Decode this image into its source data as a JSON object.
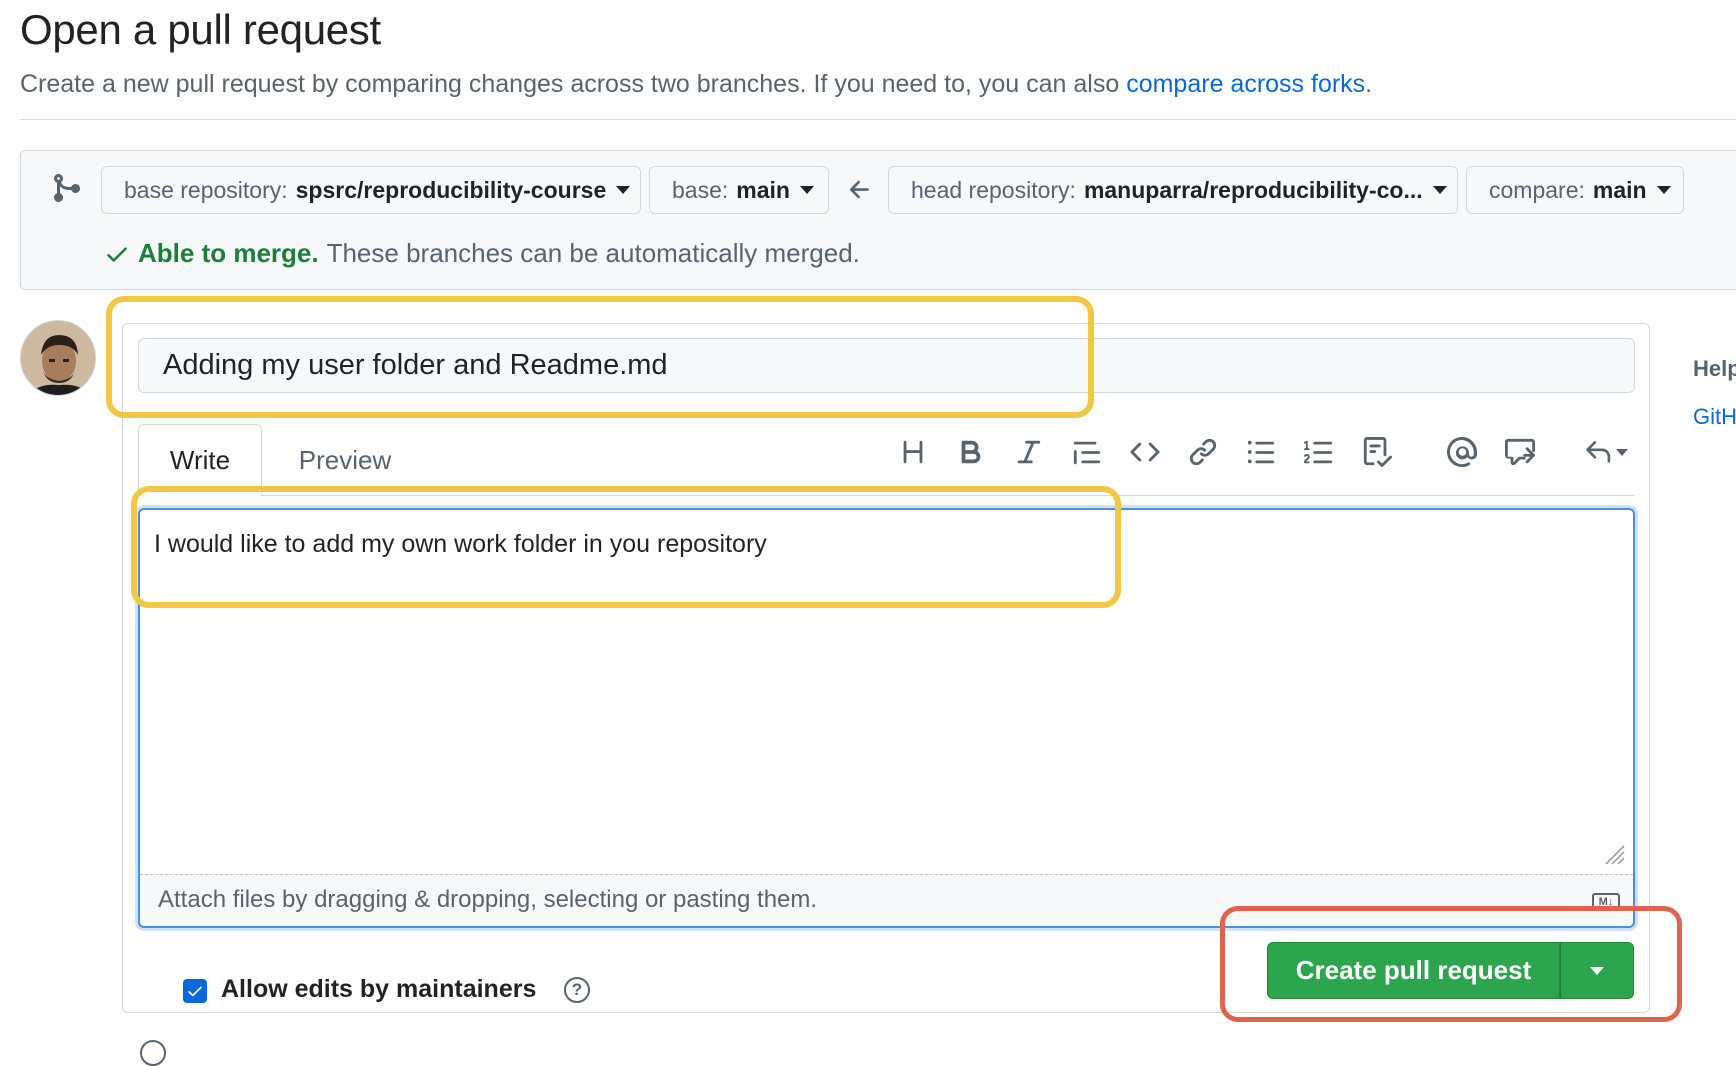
{
  "header": {
    "title": "Open a pull request",
    "subtitle": "Create a new pull request by comparing changes across two branches. If you need to, you can also ",
    "subtitle_link": "compare across forks",
    "subtitle_end": "."
  },
  "compare": {
    "base_repo_label": "base repository:",
    "base_repo_value": "spsrc/reproducibility-course",
    "base_label": "base:",
    "base_value": "main",
    "head_repo_label": "head repository:",
    "head_repo_value": "manuparra/reproducibility-co...",
    "compare_label": "compare:",
    "compare_value": "main",
    "status_ok": "Able to merge.",
    "status_desc": "These branches can be automatically merged."
  },
  "form": {
    "title_value": "Adding my user folder and Readme.md",
    "tabs": [
      "Write",
      "Preview"
    ],
    "toolbar": [
      "heading-icon",
      "bold-icon",
      "italic-icon",
      "quote-icon",
      "code-icon",
      "link-icon",
      "unordered-list-icon",
      "ordered-list-icon",
      "task-list-icon",
      "mention-icon",
      "reference-icon",
      "reply-icon"
    ],
    "body_value": "I would like to add my own work folder in you repository",
    "attach_text": "Attach files by dragging & dropping, selecting or pasting them.",
    "allow_edits_label": "Allow edits by maintainers",
    "allow_edits_checked": true,
    "create_label": "Create pull request"
  },
  "sidebar": {
    "help_title": "Help",
    "help_link": "GitH"
  },
  "colors": {
    "accent_blue": "#0969da",
    "merge_green": "#1a7f37",
    "button_green": "#2da44e",
    "highlight_yellow": "#f2c744",
    "highlight_red": "#e0634e"
  }
}
